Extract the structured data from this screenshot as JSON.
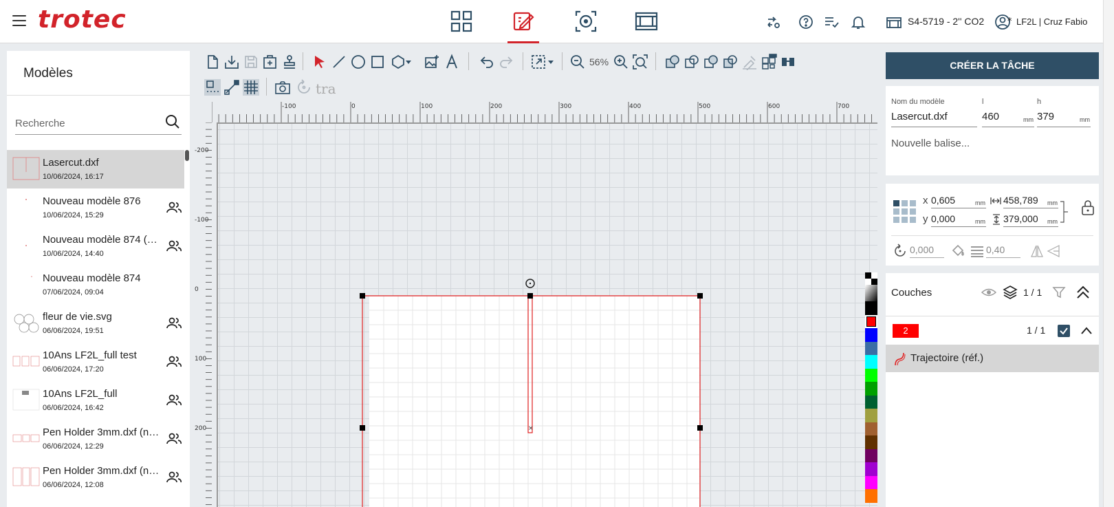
{
  "header": {
    "logo": "trotec",
    "machine": "S4-5719 - 2'' CO2",
    "user_marker": "*",
    "user": "LF2L | Cruz Fabio",
    "accent": "#d2232a"
  },
  "left_panel": {
    "title": "Modèles",
    "search_placeholder": "Recherche",
    "items": [
      {
        "name": "Lasercut.dxf",
        "date": "10/06/2024, 16:17",
        "shared": false
      },
      {
        "name": "Nouveau modèle 876",
        "date": "10/06/2024, 15:29",
        "shared": true
      },
      {
        "name": "Nouveau modèle 874 (n…",
        "date": "10/06/2024, 14:40",
        "shared": true
      },
      {
        "name": "Nouveau modèle 874",
        "date": "07/06/2024, 09:04",
        "shared": false
      },
      {
        "name": "fleur de vie.svg",
        "date": "06/06/2024, 19:51",
        "shared": true
      },
      {
        "name": "10Ans LF2L_full test",
        "date": "06/06/2024, 17:20",
        "shared": true
      },
      {
        "name": "10Ans LF2L_full",
        "date": "06/06/2024, 16:42",
        "shared": true
      },
      {
        "name": "Pen Holder 3mm.dxf (n…",
        "date": "06/06/2024, 12:29",
        "shared": true
      },
      {
        "name": "Pen Holder 3mm.dxf (n…",
        "date": "06/06/2024, 12:08",
        "shared": true
      }
    ]
  },
  "toolbar": {
    "zoom": "56%",
    "text_tool": "tra"
  },
  "rulers": {
    "h_labels": [
      "-100",
      "0",
      "100",
      "200",
      "300",
      "400",
      "500",
      "600",
      "700"
    ],
    "v_labels": [
      "-200",
      "-100",
      "0",
      "100",
      "200"
    ]
  },
  "right_panel": {
    "create_button": "CRÉER LA TÂCHE",
    "design_name_label": "Nom du modèle",
    "design_name": "Lasercut.dxf",
    "width_label": "l",
    "width": "460",
    "height_label": "h",
    "height": "379",
    "unit": "mm",
    "tag_placeholder": "Nouvelle balise...",
    "x_label": "x",
    "x": "0,605",
    "y_label": "y",
    "y": "0,000",
    "w": "458,789",
    "h": "379,000",
    "rotation": "0,000",
    "line_width": "0,40",
    "layers_title": "Couches",
    "layers_count": "1 / 1",
    "layer_number": "2",
    "layer_count": "1 / 1",
    "layer_color": "#ff0000",
    "path_label": "Trajectoire (réf.)"
  },
  "palette": [
    "#000000",
    "#ff0000",
    "#0000ff",
    "#3b6ea5",
    "#00ffff",
    "#00ff00",
    "#00a000",
    "#006030",
    "#a0a040",
    "#a06030",
    "#603000",
    "#700060",
    "#a000d0",
    "#ff00ff",
    "#ff7000"
  ]
}
